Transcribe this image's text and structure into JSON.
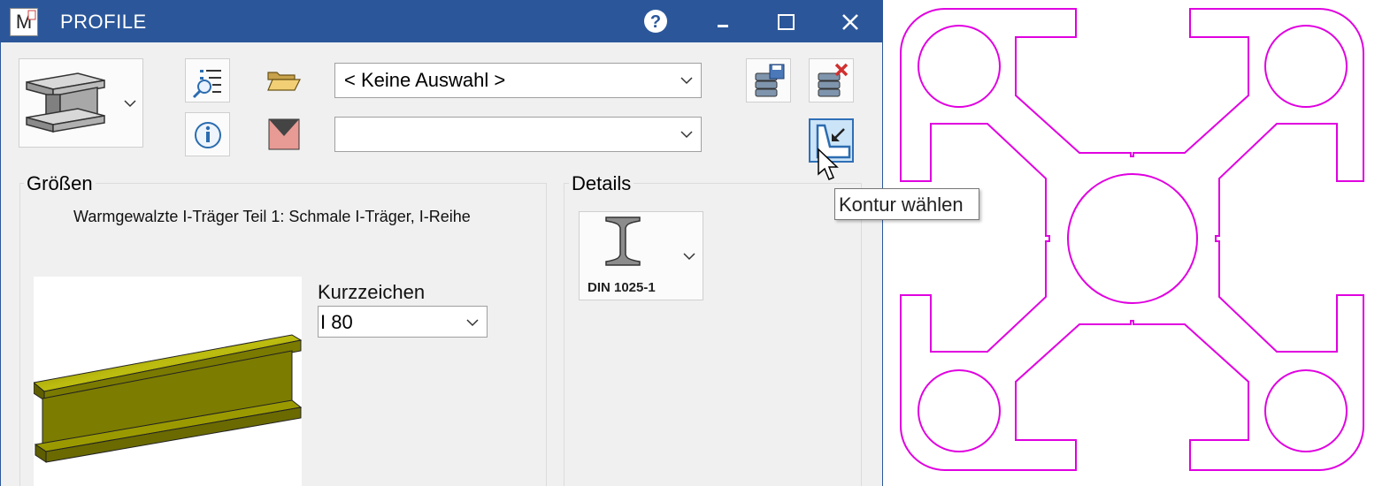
{
  "window": {
    "title": "PROFILE",
    "app_icon_letter": "M"
  },
  "toolbar": {
    "catalog_combo_value": "< Keine Auswahl >",
    "second_combo_value": ""
  },
  "groups": {
    "sizes": {
      "label": "Größen",
      "description": "Warmgewalzte I-Träger Teil 1: Schmale I-Träger, I-Reihe",
      "designation_label": "Kurzzeichen",
      "designation_value": "I 80"
    },
    "details": {
      "label": "Details",
      "norm_label": "DIN 1025-1"
    }
  },
  "tooltip": {
    "text": "Kontur wählen"
  },
  "colors": {
    "titlebar": "#2b579a",
    "dialog_bg": "#f0f0f0",
    "contour": "#e000e0",
    "beam": "#7a7a00"
  },
  "icons": [
    "app-icon",
    "help-icon",
    "minimize-icon",
    "maximize-icon",
    "close-icon",
    "i-beam-icon",
    "search-list-icon",
    "info-icon",
    "folder-open-icon",
    "color-swatch-icon",
    "database-save-icon",
    "database-delete-icon",
    "select-contour-icon",
    "chevron-down-icon",
    "mouse-cursor-icon"
  ]
}
